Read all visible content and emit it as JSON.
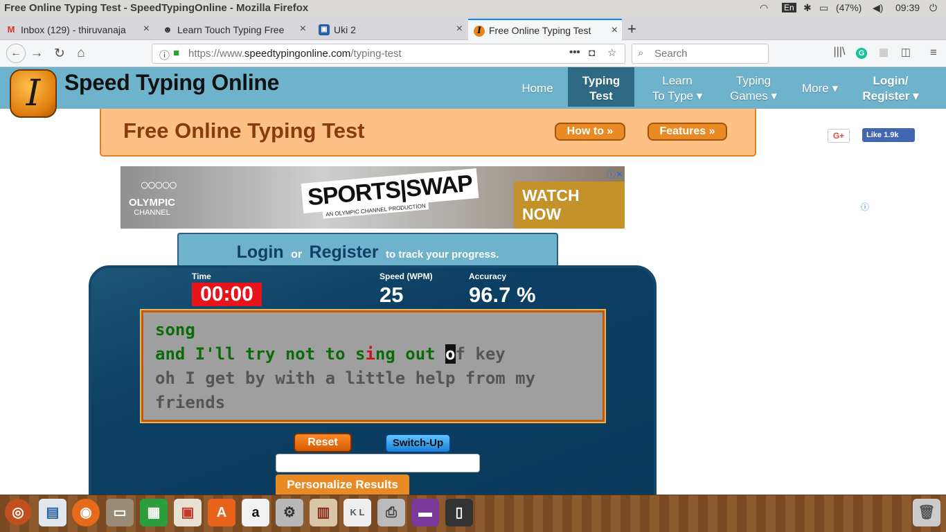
{
  "os": {
    "window_title": "Free Online Typing Test - SpeedTypingOnline - Mozilla Firefox",
    "lang": "En",
    "battery": "(47%)",
    "time": "09:39"
  },
  "tabs": [
    {
      "label": "Inbox (129) - thiruvanaja",
      "icon": "M"
    },
    {
      "label": "Learn Touch Typing Free",
      "icon": "☻"
    },
    {
      "label": "Uki 2",
      "icon": "▣"
    },
    {
      "label": "Free Online Typing Test",
      "icon": "I"
    }
  ],
  "nav": {
    "url_prefix": "https://www.",
    "url_domain": "speedtypingonline.com",
    "url_path": "/typing-test",
    "search_placeholder": "Search"
  },
  "site": {
    "name": "Speed Typing Online",
    "logo_letter": "I",
    "menu": [
      {
        "l1": "Home",
        "l2": ""
      },
      {
        "l1": "Typing",
        "l2": "Test"
      },
      {
        "l1": "Learn",
        "l2": "To Type ▾"
      },
      {
        "l1": "Typing",
        "l2": "Games ▾"
      },
      {
        "l1": "More ▾",
        "l2": ""
      },
      {
        "l1": "Login/",
        "l2": "Register ▾"
      }
    ]
  },
  "banner": {
    "title": "Free Online Typing Test",
    "howto": "How to »",
    "features": "Features »",
    "gplus": "G+",
    "fb_like": "Like 1.9k"
  },
  "ad": {
    "brand": "OLYMPIC",
    "brand2": "CHANNEL",
    "headline": "SPORTS|SWAP",
    "sub": "AN OLYMPIC CHANNEL PRODUCTION",
    "cta": "WATCH NOW"
  },
  "login": {
    "login": "Login",
    "or": "or",
    "register": "Register",
    "tail": "to track your progress."
  },
  "stats": {
    "time_label": "Time",
    "time": "00:00",
    "speed_label": "Speed (WPM)",
    "speed": "25",
    "acc_label": "Accuracy",
    "accuracy": "96.7 %"
  },
  "typing": {
    "line1": "song",
    "line2_a": "and I'll try not to s",
    "line2_err": "i",
    "line2_b": "ng out ",
    "line2_cur": "o",
    "line2_rest": "f key",
    "line3": "oh I get by with a little help from my",
    "line4": "friends"
  },
  "buttons": {
    "reset": "Reset",
    "switch": "Switch-Up",
    "personalize": "Personalize Results"
  }
}
